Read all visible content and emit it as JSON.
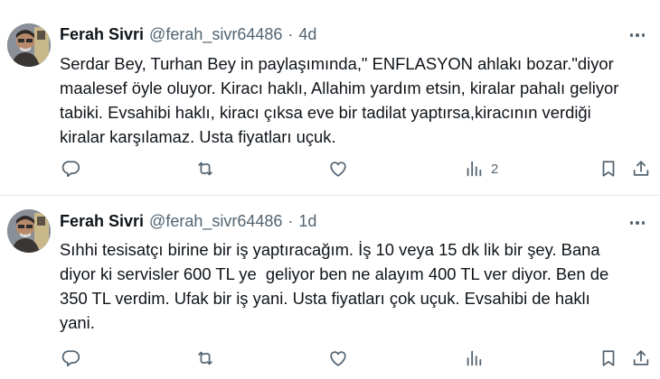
{
  "tweets": [
    {
      "author_name": "Ferah Sivri",
      "handle": "@ferah_sivr64486",
      "separator": "·",
      "time": "4d",
      "text": "Serdar Bey, Turhan Bey in paylaşımında,\" ENFLASYON ahlakı bozar.\"diyor\nmaalesef öyle oluyor. Kiracı haklı, Allahim yardım etsin, kiralar pahalı geliyor\ntabiki. Evsahibi haklı, kiracı çıksa eve bir tadilat yaptırsa,kiracının verdiği\nkiralar karşılamaz. Usta fiyatları uçuk.",
      "views_count": "2"
    },
    {
      "author_name": "Ferah Sivri",
      "handle": "@ferah_sivr64486",
      "separator": "·",
      "time": "1d",
      "text": "Sıhhi tesisatçı birine bir iş yaptıracağım. İş 10 veya 15 dk lik bir şey. Bana\ndiyor ki servisler 600 TL ye  geliyor ben ne alayım 400 TL ver diyor. Ben de\n350 TL verdim. Ufak bir iş yani. Usta fiyatları çok uçuk. Evsahibi de haklı\nyani.",
      "views_count": ""
    }
  ],
  "icons": {
    "reply": "reply-icon",
    "retweet": "retweet-icon",
    "like": "heart-icon",
    "views": "views-icon",
    "bookmark": "bookmark-icon",
    "share": "share-icon",
    "more": "more-icon"
  },
  "colors": {
    "text": "#0f1419",
    "secondary": "#536471",
    "divider": "#e7e9ea"
  }
}
